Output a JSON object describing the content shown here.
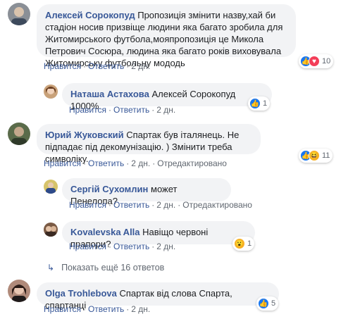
{
  "comments": [
    {
      "author": "Алексей Сорокопуд",
      "text": "Пропозиція змінити назву,хай би стадіон носив призвіще людини яка багато зробила для Житомирського футбола,мояпропозиція це Микола Петрович Сосюра, людина яка багато років виховувала Житомирську футбольну мододь",
      "like": "Нравится",
      "reply": "Ответить",
      "time": "2 дн.",
      "reactions": "10"
    },
    {
      "author": "Наташа Астахова",
      "text": "Алексей Сорокопуд 1000%",
      "like": "Нравится",
      "reply": "Ответить",
      "time": "2 дн.",
      "reactions": "1"
    },
    {
      "author": "Юрий Жуковский",
      "text": "Спартак був італянець. Не підпадає під декомунізацію. ) Змінити треба символіку.",
      "like": "Нравится",
      "reply": "Ответить",
      "time": "2 дн.",
      "edited": "Отредактировано",
      "reactions": "11"
    },
    {
      "author": "Сергій Сухомлин",
      "text": "может Пенелопа?",
      "like": "Нравится",
      "reply": "Ответить",
      "time": "2 дн.",
      "edited": "Отредактировано"
    },
    {
      "author": "Kovalevska Alla",
      "text": "Навіщо червоні прапори?",
      "like": "Нравится",
      "reply": "Ответить",
      "time": "2 дн.",
      "reactions": "1"
    },
    {
      "author": "Olga Trohlebova",
      "text": "Спартак від слова Спарта, спартанці",
      "like": "Нравится",
      "reply": "Ответить",
      "time": "2 дн.",
      "reactions": "5"
    }
  ],
  "more_replies": "Показать ещё 16 ответов",
  "icons": {
    "like": "like-reaction-icon",
    "love": "love-reaction-icon",
    "haha": "haha-reaction-icon",
    "wow": "wow-reaction-icon",
    "reply_arrow": "reply-arrow-icon"
  },
  "colors": {
    "author_link": "#385898",
    "bubble": "#f2f3f5",
    "meta": "#606770",
    "like_blue": "#1877f2",
    "love_red": "#f33e58"
  }
}
